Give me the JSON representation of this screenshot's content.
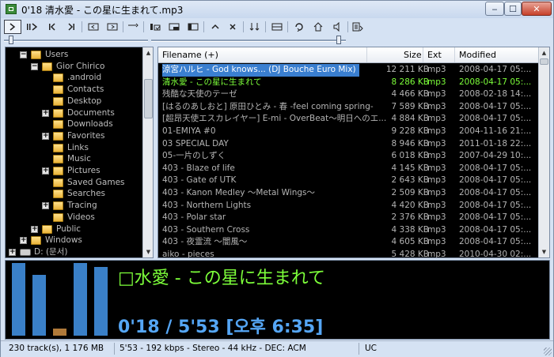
{
  "window": {
    "title": "0'18 清水愛 - この星に生まれて.mp3",
    "minimize": "‒",
    "maximize": "☐",
    "close": "✕"
  },
  "toolbar": {
    "buttons": [
      {
        "name": "play-icon"
      },
      {
        "name": "pause-play-icon"
      },
      {
        "name": "previous-icon"
      },
      {
        "name": "next-icon"
      },
      {
        "name": "open-file-icon"
      },
      {
        "name": "open-folder-icon"
      },
      {
        "name": "jump-icon"
      },
      {
        "name": "equalizer-icon"
      },
      {
        "name": "mini-mode-icon"
      },
      {
        "name": "panel-icon"
      },
      {
        "name": "move-up-icon"
      },
      {
        "name": "remove-icon"
      },
      {
        "name": "sort-icon"
      },
      {
        "name": "layout-icon"
      },
      {
        "name": "repeat-icon"
      },
      {
        "name": "home-icon"
      },
      {
        "name": "volume-icon"
      },
      {
        "name": "playlist-info-icon"
      }
    ]
  },
  "tree": {
    "items": [
      {
        "label": "Users",
        "expander": "−",
        "level": 2
      },
      {
        "label": "Gior Chirico",
        "expander": "−",
        "level": 3
      },
      {
        "label": ".android",
        "expander": "",
        "level": 4
      },
      {
        "label": "Contacts",
        "expander": "",
        "level": 4
      },
      {
        "label": "Desktop",
        "expander": "",
        "level": 4
      },
      {
        "label": "Documents",
        "expander": "+",
        "level": 4
      },
      {
        "label": "Downloads",
        "expander": "",
        "level": 4
      },
      {
        "label": "Favorites",
        "expander": "+",
        "level": 4
      },
      {
        "label": "Links",
        "expander": "",
        "level": 4
      },
      {
        "label": "Music",
        "expander": "",
        "level": 4
      },
      {
        "label": "Pictures",
        "expander": "+",
        "level": 4
      },
      {
        "label": "Saved Games",
        "expander": "",
        "level": 4
      },
      {
        "label": "Searches",
        "expander": "",
        "level": 4
      },
      {
        "label": "Tracing",
        "expander": "+",
        "level": 4
      },
      {
        "label": "Videos",
        "expander": "",
        "level": 4
      },
      {
        "label": "Public",
        "expander": "+",
        "level": 3
      },
      {
        "label": "Windows",
        "expander": "+",
        "level": 2
      },
      {
        "label": "D: (문서)",
        "expander": "+",
        "level": 1,
        "drive": true
      }
    ]
  },
  "list": {
    "headers": {
      "filename": "Filename (+)",
      "size": "Size",
      "ext": "Ext",
      "modified": "Modified"
    },
    "rows": [
      {
        "filename": "涼宮ハルヒ - God knows... (DJ Bouche Euro Mix)",
        "size": "12 211 KB",
        "ext": "mp3",
        "modified": "2008-04-17 05:...",
        "state": "selected"
      },
      {
        "filename": "清水愛 - この星に生まれて",
        "size": "8 286 KB",
        "ext": "mp3",
        "modified": "2008-04-17 05:...",
        "state": "playing"
      },
      {
        "filename": "残酷な天使のテーゼ",
        "size": "4 466 KB",
        "ext": "mp3",
        "modified": "2008-02-18 14:..."
      },
      {
        "filename": "[はるのあしおと] 原田ひとみ - 春 -feel coming spring-",
        "size": "7 589 KB",
        "ext": "mp3",
        "modified": "2008-04-17 05:..."
      },
      {
        "filename": "[超昂天使エスカレイヤー] E-mi - OverBeat～明日へのエ...",
        "size": "4 884 KB",
        "ext": "mp3",
        "modified": "2008-04-17 05:..."
      },
      {
        "filename": "01-EMIYA #0",
        "size": "9 228 KB",
        "ext": "mp3",
        "modified": "2004-11-16 21:..."
      },
      {
        "filename": "03 SPECIAL DAY",
        "size": "8 946 KB",
        "ext": "mp3",
        "modified": "2011-01-18 22:..."
      },
      {
        "filename": "05-一片のしずく",
        "size": "6 018 KB",
        "ext": "mp3",
        "modified": "2007-04-29 10:..."
      },
      {
        "filename": "403 - Blaze of life",
        "size": "4 145 KB",
        "ext": "mp3",
        "modified": "2008-04-17 05:..."
      },
      {
        "filename": "403 - Gate of UTK",
        "size": "2 643 KB",
        "ext": "mp3",
        "modified": "2008-04-17 05:..."
      },
      {
        "filename": "403 - Kanon Medley ～Metal Wings～",
        "size": "2 509 KB",
        "ext": "mp3",
        "modified": "2008-04-17 05:..."
      },
      {
        "filename": "403 - Northern Lights",
        "size": "4 420 KB",
        "ext": "mp3",
        "modified": "2008-04-17 05:..."
      },
      {
        "filename": "403 - Polar star",
        "size": "2 376 KB",
        "ext": "mp3",
        "modified": "2008-04-17 05:..."
      },
      {
        "filename": "403 - Southern Cross",
        "size": "4 338 KB",
        "ext": "mp3",
        "modified": "2008-04-17 05:..."
      },
      {
        "filename": "403 - 夜霊流 ～闇風～",
        "size": "4 605 KB",
        "ext": "mp3",
        "modified": "2008-04-17 05:..."
      },
      {
        "filename": "aiko - pieces",
        "size": "5 428 KB",
        "ext": "mp3",
        "modified": "2010-04-30 02:..."
      }
    ]
  },
  "player": {
    "now_playing": "□水愛 - この星に生まれて",
    "time": "0'18 / 5'53   [오후 6:35]",
    "visualizer_levels": [
      1.0,
      0.84,
      0.1,
      1.0,
      0.95
    ],
    "colors": {
      "title": "#7dff3a",
      "time": "#55a6f5",
      "bars": "#3a80c8"
    }
  },
  "status": {
    "tracks": "230 track(s), 1 176 MB",
    "format": "5'53 - 192 kbps - Stereo - 44 kHz - DEC: ACM",
    "mode": "UC"
  }
}
